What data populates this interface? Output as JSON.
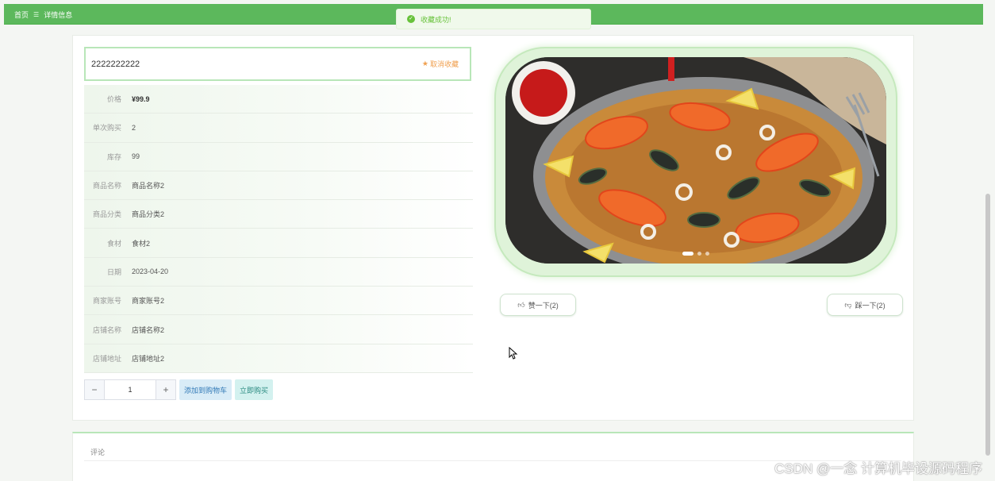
{
  "breadcrumb": {
    "home": "首页",
    "separator": "☰",
    "current": "详情信息"
  },
  "toast": {
    "message": "收藏成功!",
    "icon": "check-circle-icon"
  },
  "product": {
    "title": "2222222222",
    "favorite_label": "取消收藏",
    "fields": [
      {
        "label": "价格",
        "value": "¥99.9"
      },
      {
        "label": "单次购买",
        "value": "2"
      },
      {
        "label": "库存",
        "value": "99"
      },
      {
        "label": "商品名称",
        "value": "商品名称2"
      },
      {
        "label": "商品分类",
        "value": "商品分类2"
      },
      {
        "label": "食材",
        "value": "食材2"
      },
      {
        "label": "日期",
        "value": "2023-04-20"
      },
      {
        "label": "商家账号",
        "value": "商家账号2"
      },
      {
        "label": "店铺名称",
        "value": "店铺名称2"
      },
      {
        "label": "店铺地址",
        "value": "店铺地址2"
      }
    ]
  },
  "purchase": {
    "minus": "−",
    "quantity": "1",
    "plus": "+",
    "add_to_cart": "添加到购物车",
    "buy_now": "立即购买"
  },
  "votes": {
    "like": "赞一下(2)",
    "dislike": "踩一下(2)"
  },
  "comments": {
    "title": "评论"
  },
  "watermark": "CSDN @一念 计算机毕设源码程序",
  "colors": {
    "brand": "#5cb85c",
    "success": "#67c23a",
    "favorite": "#f0a050"
  }
}
